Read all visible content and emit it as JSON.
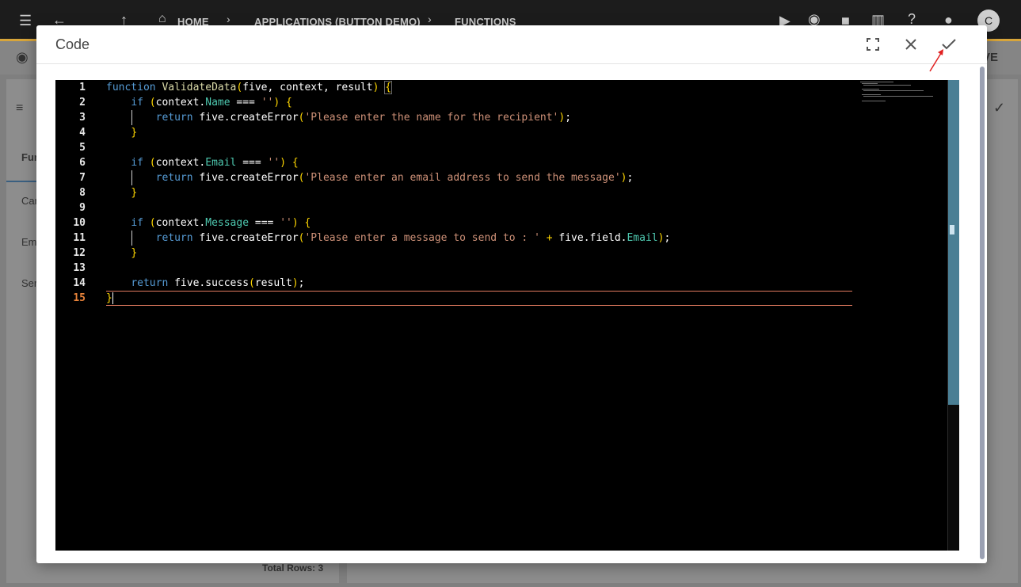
{
  "background": {
    "breadcrumb": [
      "HOME",
      "APPLICATIONS (BUTTON DEMO)",
      "FUNCTIONS"
    ],
    "left_tabs": [
      "Fun",
      "Car",
      "Em",
      "Ser"
    ],
    "total_rows": "Total Rows: 3",
    "right_header_fragment": "VE"
  },
  "modal": {
    "title": "Code",
    "buttons": {
      "fullscreen": "fullscreen-icon",
      "close": "close-icon",
      "confirm": "check-icon"
    }
  },
  "editor": {
    "current_line": 15,
    "line_numbers": [
      "1",
      "2",
      "3",
      "4",
      "5",
      "6",
      "7",
      "8",
      "9",
      "10",
      "11",
      "12",
      "13",
      "14",
      "15"
    ],
    "lines": [
      "function ValidateData(five, context, result) {",
      "    if (context.Name === '') {",
      "        return five.createError('Please enter the name for the recipient');",
      "    }",
      "",
      "    if (context.Email === '') {",
      "        return five.createError('Please enter an email address to send the message');",
      "    }",
      "",
      "    if (context.Message === '') {",
      "        return five.createError('Please enter a message to send to : ' + five.field.Email);",
      "    }",
      "",
      "    return five.success(result);",
      "}"
    ],
    "tokens": {
      "l1": {
        "kw": "function",
        "fn": "ValidateData",
        "open": "(",
        "args": "five, context, result",
        "close": ")",
        "brace": "{"
      },
      "l2": {
        "kw": "if",
        "open": "(",
        "obj": "context.",
        "prop": "Name",
        "op": " === ",
        "str": "''",
        "close": ")",
        "brace": "{"
      },
      "l3": {
        "kw": "return",
        "call": "five.createError",
        "open": "(",
        "str": "'Please enter the name for the recipient'",
        "close": ")",
        "end": ";"
      },
      "l4": {
        "brace": "}"
      },
      "l6": {
        "kw": "if",
        "open": "(",
        "obj": "context.",
        "prop": "Email",
        "op": " === ",
        "str": "''",
        "close": ")",
        "brace": "{"
      },
      "l7": {
        "kw": "return",
        "call": "five.createError",
        "open": "(",
        "str": "'Please enter an email address to send the message'",
        "close": ")",
        "end": ";"
      },
      "l8": {
        "brace": "}"
      },
      "l10": {
        "kw": "if",
        "open": "(",
        "obj": "context.",
        "prop": "Message",
        "op": " === ",
        "str": "''",
        "close": ")",
        "brace": "{"
      },
      "l11": {
        "kw": "return",
        "call": "five.createError",
        "open": "(",
        "str": "'Please enter a message to send to : '",
        "plus": " + ",
        "obj": "five.field.",
        "prop": "Email",
        "close": ")",
        "end": ";"
      },
      "l12": {
        "brace": "}"
      },
      "l14": {
        "kw": "return",
        "call": "five.success",
        "open": "(",
        "args": "result",
        "close": ")",
        "end": ";"
      },
      "l15": {
        "brace": "}"
      }
    }
  },
  "colors": {
    "editor_bg": "#000000",
    "keyword": "#569cd6",
    "function": "#dcdcaa",
    "bracket": "#ffd700",
    "string": "#ce9178",
    "property": "#4ec9b0",
    "current_line_border": "#e07a5f",
    "annotation_arrow": "#e02020"
  }
}
